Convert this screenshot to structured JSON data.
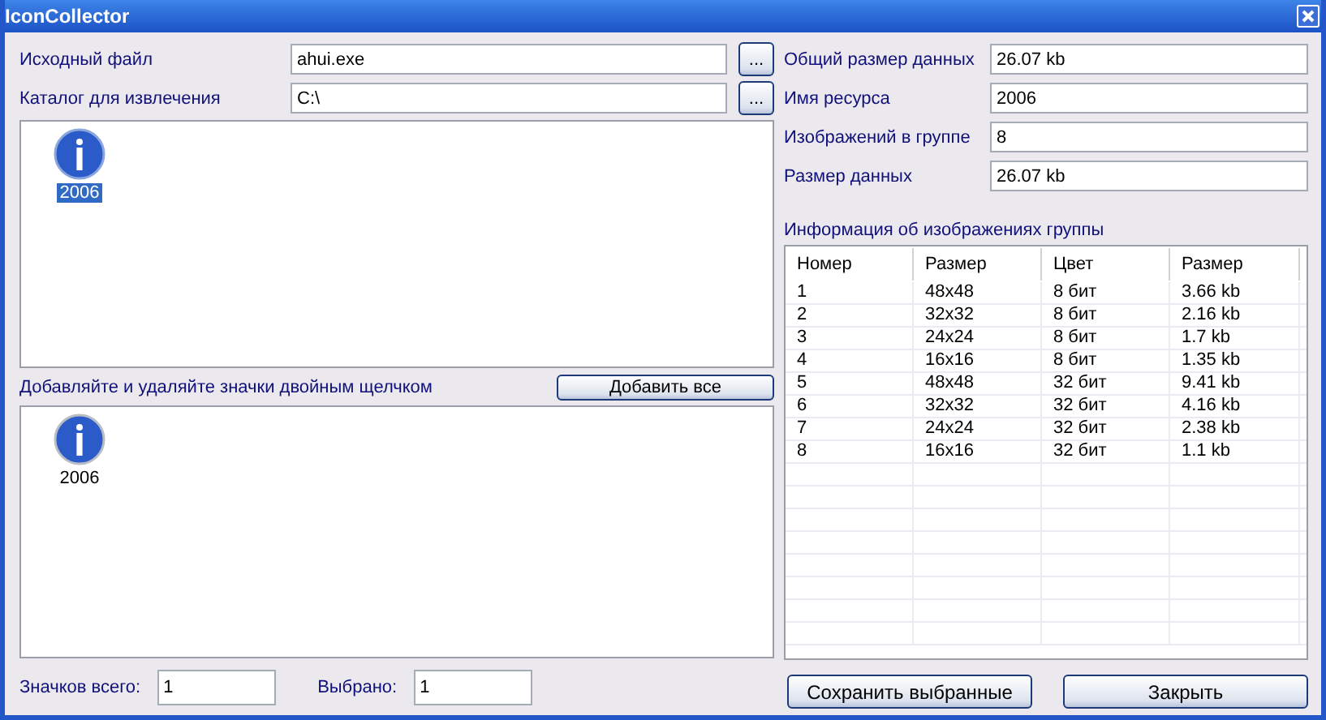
{
  "window": {
    "title": "IconCollector"
  },
  "source_fields": [
    {
      "label": "Исходный файл",
      "value": "ahui.exe",
      "browse": "..."
    },
    {
      "label": "Каталог для извлечения",
      "value": "C:\\",
      "browse": "..."
    }
  ],
  "extracted_icons": [
    {
      "label": "2006",
      "selected": true
    }
  ],
  "hint": "Добавляйте и удаляйте значки двойным щелчком",
  "add_all_button": "Добавить все",
  "collected_icons": [
    {
      "label": "2006",
      "selected": false
    }
  ],
  "counts": [
    {
      "label": "Значков всего:",
      "value": "1"
    },
    {
      "label": "Выбрано:",
      "value": "1"
    }
  ],
  "info_fields": [
    {
      "label": "Общий размер данных",
      "value": "26.07 kb"
    },
    {
      "label": "Имя ресурса",
      "value": "2006"
    },
    {
      "label": "Изображений в группе",
      "value": "8"
    },
    {
      "label": "Размер данных",
      "value": "26.07 kb"
    }
  ],
  "table": {
    "title": "Информация об изображениях группы",
    "columns": [
      "Номер",
      "Размер",
      "Цвет",
      "Размер"
    ],
    "rows": [
      [
        "1",
        "48x48",
        "8 бит",
        "3.66 kb"
      ],
      [
        "2",
        "32x32",
        "8 бит",
        "2.16 kb"
      ],
      [
        "3",
        "24x24",
        "8 бит",
        "1.7 kb"
      ],
      [
        "4",
        "16x16",
        "8 бит",
        "1.35 kb"
      ],
      [
        "5",
        "48x48",
        "32 бит",
        "9.41 kb"
      ],
      [
        "6",
        "32x32",
        "32 бит",
        "4.16 kb"
      ],
      [
        "7",
        "24x24",
        "32 бит",
        "2.38 kb"
      ],
      [
        "8",
        "16x16",
        "32 бит",
        "1.1 kb"
      ]
    ]
  },
  "buttons": [
    "Сохранить выбранные",
    "Закрыть"
  ]
}
